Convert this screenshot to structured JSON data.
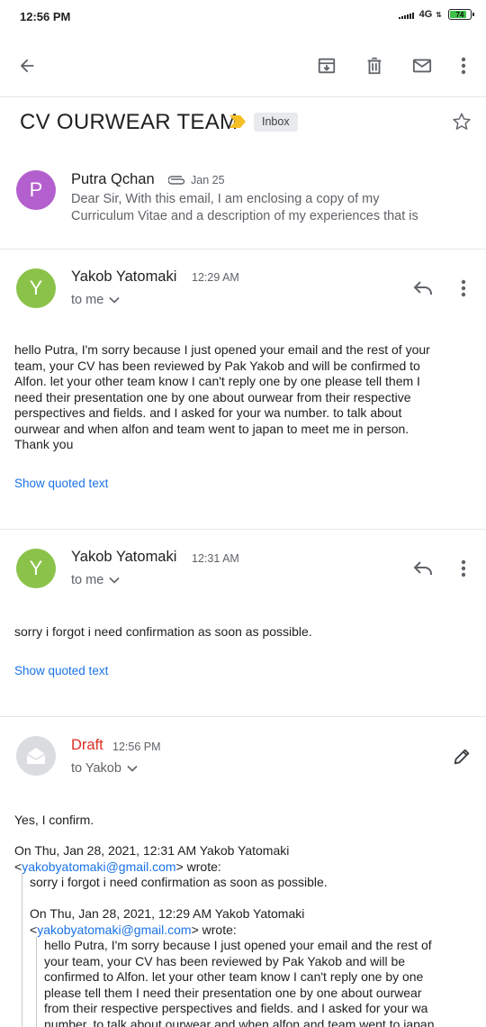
{
  "status": {
    "time": "12:56 PM",
    "network": "4G",
    "battery": "74"
  },
  "toolbar": {
    "back_icon": "back-arrow-icon",
    "archive_icon": "archive-icon",
    "delete_icon": "trash-icon",
    "mark_unread_icon": "mail-icon",
    "more_icon": "more-vert-icon"
  },
  "thread": {
    "subject": "CV OURWEAR TEAM",
    "label": "Inbox"
  },
  "messages": [
    {
      "avatar_letter": "P",
      "avatar_color": "#b35fce",
      "sender": "Putra Qchan",
      "date": "Jan 25",
      "snippet_line1": "Dear Sir, With this email, I am enclosing a copy of my",
      "snippet_line2": "Curriculum Vitae and a description of my experiences that is"
    },
    {
      "avatar_letter": "Y",
      "avatar_color": "#8bc34a",
      "sender": "Yakob Yatomaki",
      "time": "12:29 AM",
      "to": "to me",
      "body_lines": [
        "hello Putra, I'm sorry because I just opened your email and the rest of your",
        "team, your CV has been reviewed by Pak Yakob and will be confirmed to",
        "Alfon.  let your other team know I can't reply one by one please tell them I",
        "need their presentation one by one about ourwear from their respective",
        "perspectives and fields.  and I asked for your wa number.  to talk about",
        "ourwear and when alfon and team went to japan to meet me in person.",
        "Thank you"
      ],
      "show_quoted": "Show quoted text"
    },
    {
      "avatar_letter": "Y",
      "avatar_color": "#8bc34a",
      "sender": "Yakob Yatomaki",
      "time": "12:31 AM",
      "to": "to me",
      "body_lines": [
        "sorry i forgot i need confirmation as soon as possible."
      ],
      "show_quoted": "Show quoted text"
    }
  ],
  "draft": {
    "label": "Draft",
    "time": "12:56 PM",
    "to": "to Yakob",
    "reply": "Yes, I confirm.",
    "quote1_header_line1": "On Thu, Jan 28, 2021, 12:31 AM Yakob Yatomaki",
    "quote1_email": "yakobyatomaki@gmail.com",
    "quote1_open": "<",
    "quote1_close": "> wrote:",
    "quote1_body": "sorry i forgot i need confirmation as soon as possible.",
    "quote2_header_line1": "On Thu, Jan 28, 2021, 12:29 AM Yakob Yatomaki",
    "quote2_email": "yakobyatomaki@gmail.com",
    "quote2_open": "<",
    "quote2_close": "> wrote:",
    "quote2_body_lines": [
      "hello Putra, I'm sorry because I just opened your email and the rest of",
      "your team, your CV has been reviewed by Pak Yakob and will be",
      "confirmed to Alfon.  let your other team know I can't reply one by one",
      "please tell them I need their presentation one by one about ourwear",
      "from their respective perspectives and fields.  and I asked for your wa",
      "number.  to talk about ourwear and when alfon and team went to japan"
    ]
  },
  "colors": {
    "link": "#1a73e8",
    "draft": "#d93025",
    "importance": "#f6bf26"
  }
}
